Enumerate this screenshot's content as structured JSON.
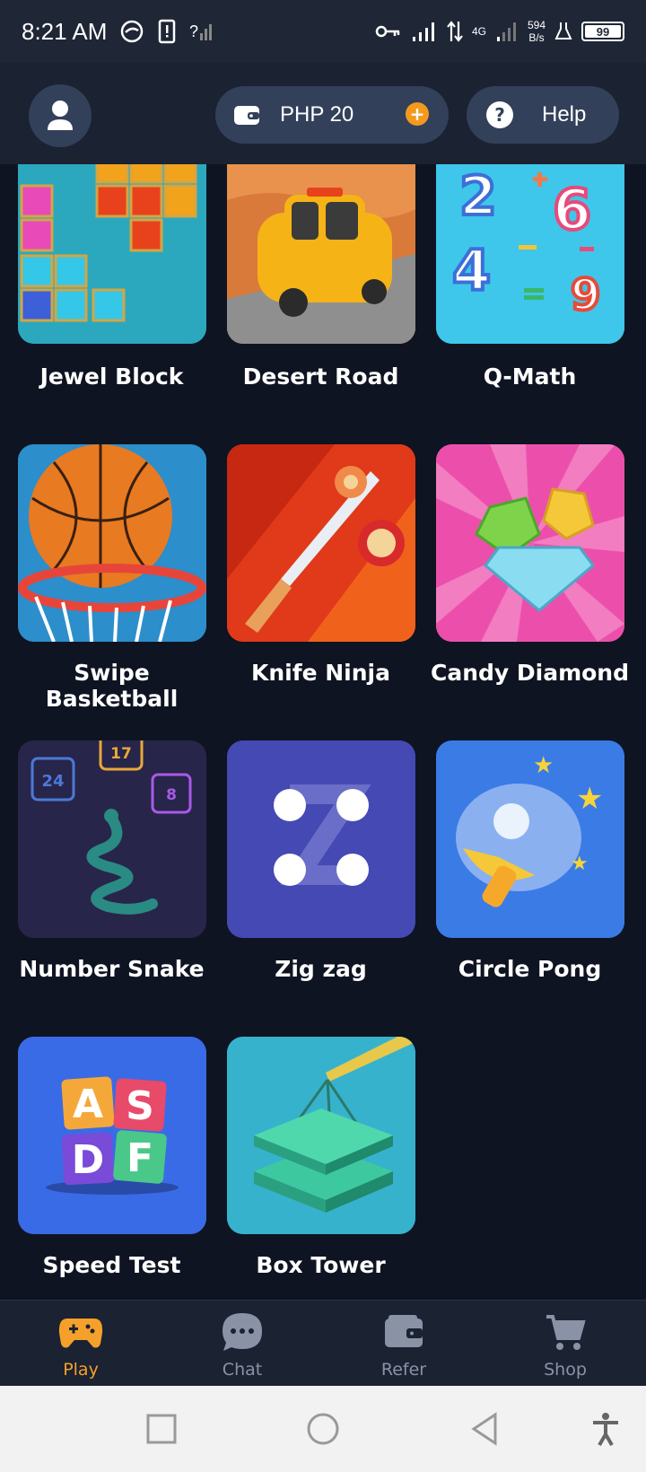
{
  "status_bar": {
    "time": "8:21 AM",
    "network_speed": "594",
    "network_unit": "B/s",
    "network_type": "4G",
    "battery": "99"
  },
  "header": {
    "wallet_label": "PHP 20",
    "help_label": "Help"
  },
  "games": [
    {
      "name": "Jewel Block"
    },
    {
      "name": "Desert Road"
    },
    {
      "name": "Q-Math"
    },
    {
      "name": "Swipe Basketball"
    },
    {
      "name": "Knife Ninja"
    },
    {
      "name": "Candy Diamond"
    },
    {
      "name": "Number Snake"
    },
    {
      "name": "Zig zag"
    },
    {
      "name": "Circle Pong"
    },
    {
      "name": "Speed Test"
    },
    {
      "name": "Box Tower"
    }
  ],
  "tile_text": {
    "snake_nums": [
      "24",
      "17",
      "8"
    ],
    "math_nums": [
      "2",
      "6",
      "4",
      "9"
    ],
    "speed_letters": [
      "A",
      "S",
      "D",
      "F"
    ]
  },
  "bottom_nav": [
    {
      "label": "Play",
      "icon": "gamepad-icon",
      "active": true
    },
    {
      "label": "Chat",
      "icon": "chat-icon",
      "active": false
    },
    {
      "label": "Refer",
      "icon": "wallet-icon",
      "active": false
    },
    {
      "label": "Shop",
      "icon": "cart-icon",
      "active": false
    }
  ],
  "colors": {
    "accent": "#f5a02a",
    "background": "#0f1422",
    "header": "#1b2232",
    "pill": "#33405a"
  }
}
